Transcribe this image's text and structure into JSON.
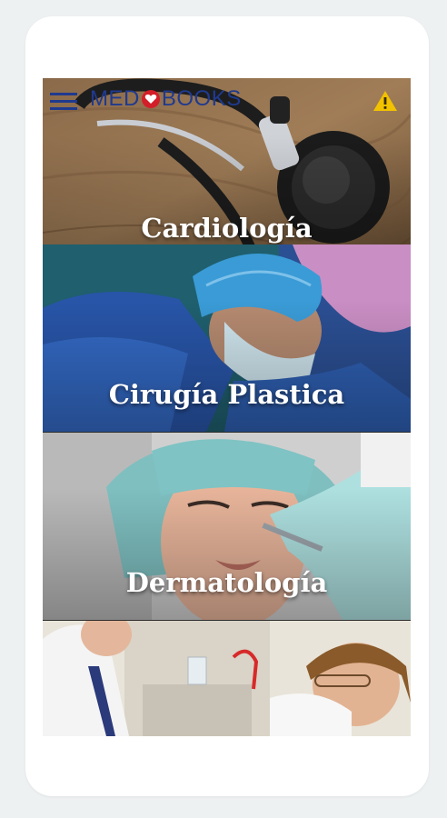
{
  "header": {
    "logo_prefix": "MED",
    "logo_suffix": "BOOKS",
    "menu_icon": "hamburger-menu-icon",
    "alert_icon": "warning-triangle-icon"
  },
  "colors": {
    "brand_blue": "#1f3a8f",
    "brand_red": "#d21f2a",
    "warning_yellow": "#f2c200",
    "page_background": "#eef1f2"
  },
  "categories": [
    {
      "label": "Cardiología"
    },
    {
      "label": "Cirugía Plastica"
    },
    {
      "label": "Dermatología"
    },
    {
      "label": ""
    }
  ]
}
